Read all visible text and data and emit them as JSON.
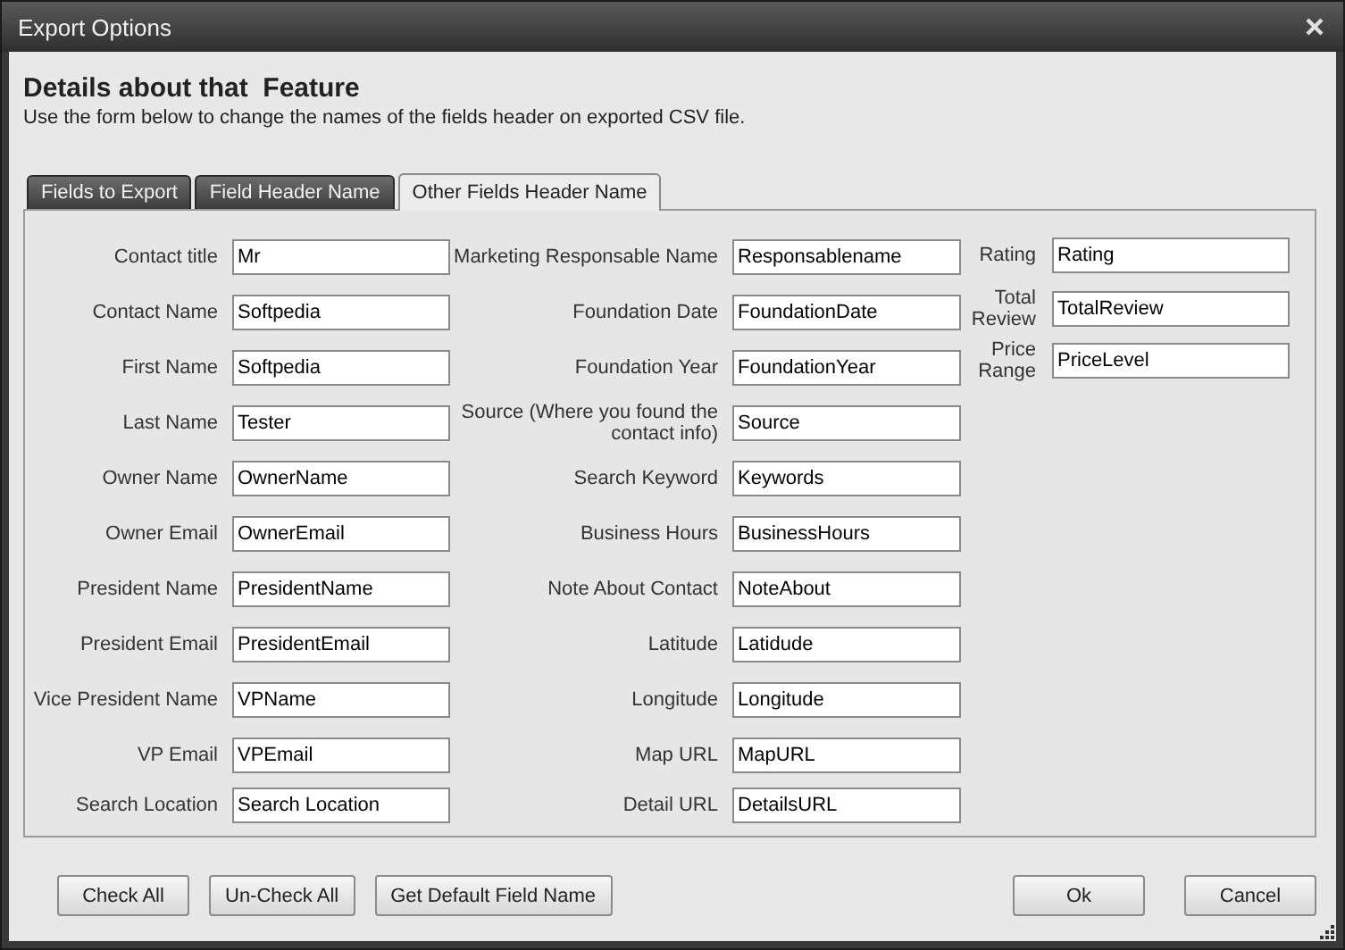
{
  "window": {
    "title": "Export Options"
  },
  "header": {
    "title": "Details about that  Feature",
    "subtitle": "Use the form below to change the names of the fields header on exported CSV file."
  },
  "tabs": [
    {
      "label": "Fields to Export",
      "selected": false
    },
    {
      "label": "Field Header Name",
      "selected": false
    },
    {
      "label": "Other Fields Header Name",
      "selected": true
    }
  ],
  "columns": [
    {
      "fields": [
        {
          "label": "Contact title",
          "value": "Mr"
        },
        {
          "label": "Contact Name",
          "value": "Softpedia"
        },
        {
          "label": "First Name",
          "value": "Softpedia"
        },
        {
          "label": "Last Name",
          "value": "Tester"
        },
        {
          "label": "Owner Name",
          "value": "OwnerName"
        },
        {
          "label": "Owner Email",
          "value": "OwnerEmail"
        },
        {
          "label": "President Name",
          "value": "PresidentName"
        },
        {
          "label": "President Email",
          "value": "PresidentEmail"
        },
        {
          "label": "Vice President Name",
          "value": "VPName"
        },
        {
          "label": "VP Email",
          "value": "VPEmail"
        },
        {
          "label": "Search Location",
          "value": "Search Location"
        }
      ]
    },
    {
      "fields": [
        {
          "label": "Marketing Responsable Name",
          "value": "Responsablename"
        },
        {
          "label": "Foundation Date",
          "value": "FoundationDate"
        },
        {
          "label": "Foundation Year",
          "value": "FoundationYear"
        },
        {
          "label": "Source (Where you found the contact info)",
          "value": "Source"
        },
        {
          "label": "Search Keyword",
          "value": "Keywords"
        },
        {
          "label": "Business Hours",
          "value": "BusinessHours"
        },
        {
          "label": "Note About Contact",
          "value": "NoteAbout"
        },
        {
          "label": "Latitude",
          "value": "Latidude"
        },
        {
          "label": "Longitude",
          "value": "Longitude"
        },
        {
          "label": "Map URL",
          "value": "MapURL"
        },
        {
          "label": "Detail URL",
          "value": "DetailsURL"
        }
      ]
    },
    {
      "fields": [
        {
          "label": "Rating",
          "value": "Rating"
        },
        {
          "label": "Total Review",
          "value": "TotalReview"
        },
        {
          "label": "Price Range",
          "value": "PriceLevel"
        }
      ]
    }
  ],
  "buttons_left": [
    "Check All",
    "Un-Check All",
    "Get Default Field Name"
  ],
  "buttons_right": [
    "Ok",
    "Cancel"
  ]
}
